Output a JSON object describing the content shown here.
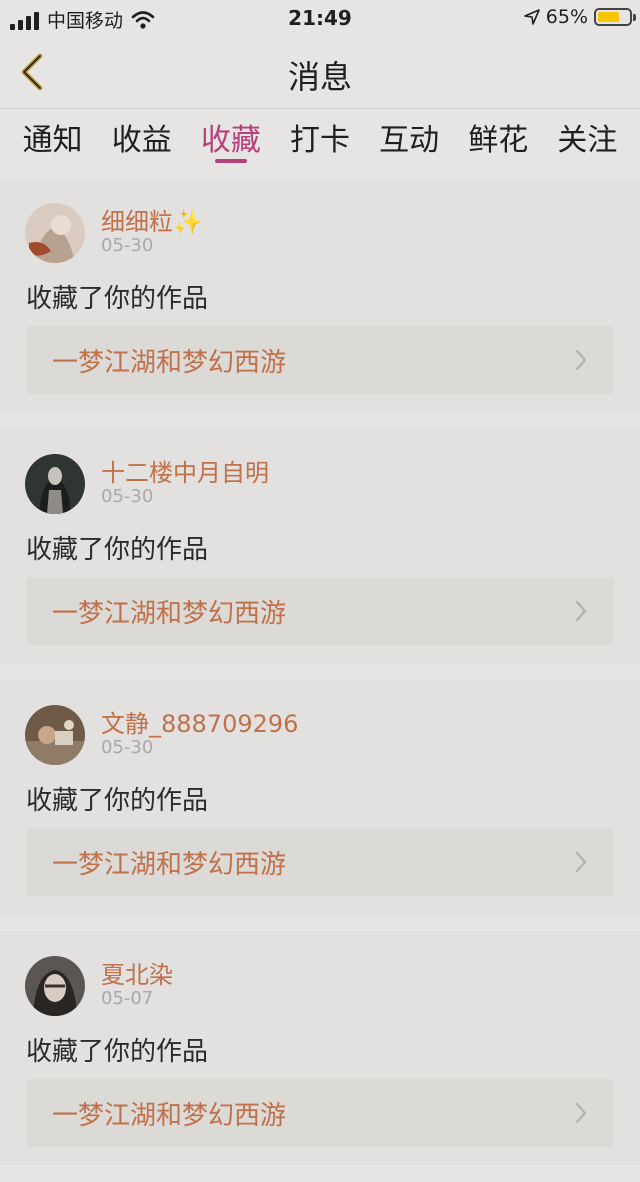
{
  "status_bar": {
    "carrier": "中国移动",
    "time": "21:49",
    "battery": "65%",
    "signal_bars": 4
  },
  "header": {
    "title": "消息"
  },
  "tabs": [
    {
      "label": "通知"
    },
    {
      "label": "收益"
    },
    {
      "label": "收藏"
    },
    {
      "label": "打卡"
    },
    {
      "label": "互动"
    },
    {
      "label": "鲜花"
    },
    {
      "label": "关注"
    }
  ],
  "active_tab": "收藏",
  "notifications": [
    {
      "user": "细细粒✨",
      "date": "05-30",
      "action": "收藏了你的作品",
      "work": "一梦江湖和梦幻西游"
    },
    {
      "user": "十二楼中月自明",
      "date": "05-30",
      "action": "收藏了你的作品",
      "work": "一梦江湖和梦幻西游"
    },
    {
      "user": "文静_888709296",
      "date": "05-30",
      "action": "收藏了你的作品",
      "work": "一梦江湖和梦幻西游"
    },
    {
      "user": "夏北染",
      "date": "05-07",
      "action": "收藏了你的作品",
      "work": "一梦江湖和梦幻西游"
    }
  ],
  "colors": {
    "accent": "#b5407a",
    "username": "#c0714a",
    "background": "#e6e5e3"
  }
}
